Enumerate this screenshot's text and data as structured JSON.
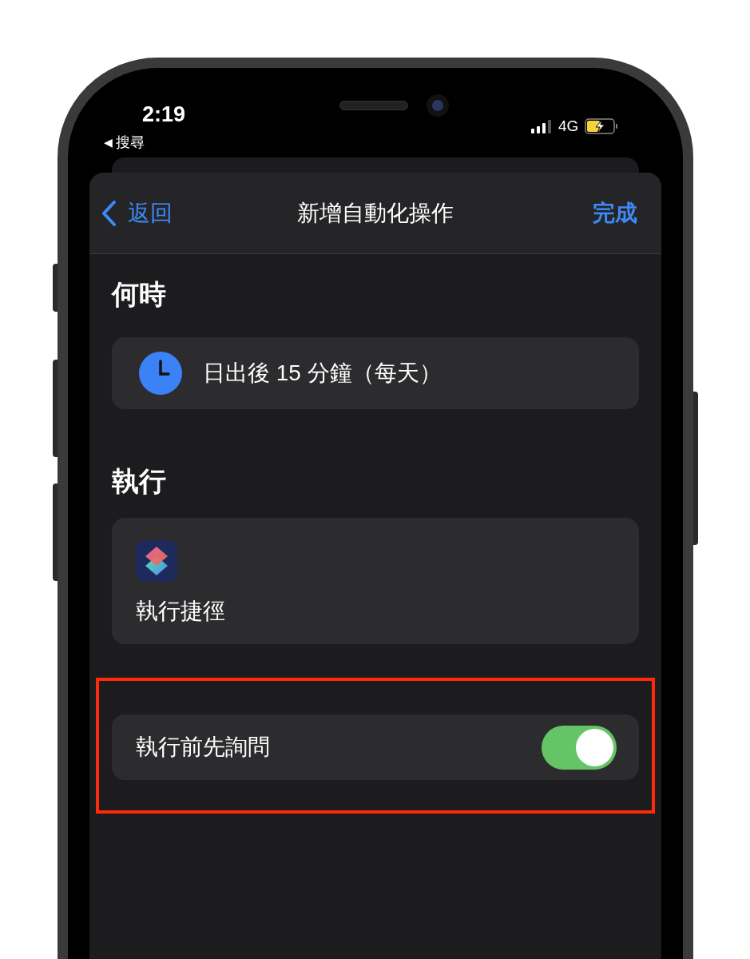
{
  "status_bar": {
    "time": "2:19",
    "back_glyph": "◀",
    "back_app": "搜尋",
    "network": "4G"
  },
  "nav_bar": {
    "back": "返回",
    "title": "新增自動化操作",
    "done": "完成"
  },
  "sections": [
    {
      "kind": "trigger",
      "header": "何時",
      "text": "日出後 15 分鐘（每天）"
    },
    {
      "kind": "action",
      "header": "執行",
      "text": "執行捷徑"
    }
  ],
  "option": {
    "label": "執行前先詢問",
    "on": true
  }
}
